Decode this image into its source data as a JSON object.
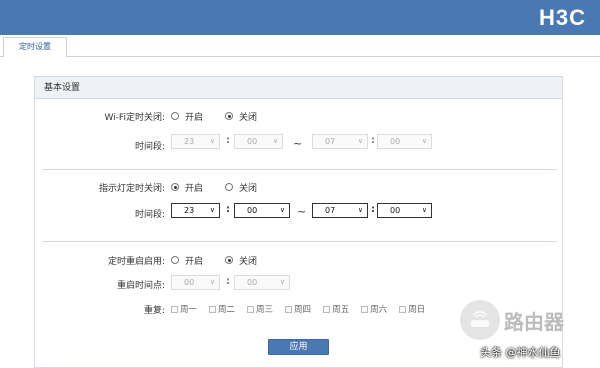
{
  "brand": {
    "logo": "H3C"
  },
  "tabs": [
    {
      "label": "定时设置"
    }
  ],
  "panel": {
    "title": "基本设置"
  },
  "wifi": {
    "label": "Wi-Fi定时关闭:",
    "options": [
      {
        "label": "开启",
        "checked": false
      },
      {
        "label": "关闭",
        "checked": true
      }
    ],
    "time_label": "时间段:",
    "start_hour": "23",
    "start_min": "00",
    "tilde": "~",
    "end_hour": "07",
    "end_min": "00",
    "colon": ":"
  },
  "led": {
    "label": "指示灯定时关闭:",
    "options": [
      {
        "label": "开启",
        "checked": true
      },
      {
        "label": "关闭",
        "checked": false
      }
    ],
    "time_label": "时间段:",
    "start_hour": "23",
    "start_min": "00",
    "tilde": "~",
    "end_hour": "07",
    "end_min": "00",
    "colon": ":"
  },
  "reboot": {
    "label": "定时重启启用:",
    "options": [
      {
        "label": "开启",
        "checked": false
      },
      {
        "label": "关闭",
        "checked": true
      }
    ],
    "time_label": "重启时间点:",
    "hour": "00",
    "min": "00",
    "colon": ":",
    "repeat_label": "重复:",
    "days": [
      "周一",
      "周二",
      "周三",
      "周四",
      "周五",
      "周六",
      "周日"
    ]
  },
  "apply_label": "应用",
  "watermark": {
    "text": "路由器",
    "credit": "头条 @神水仙鱼"
  },
  "colors": {
    "brand": "#4a78b2",
    "panel_header": "#eef2f7"
  }
}
